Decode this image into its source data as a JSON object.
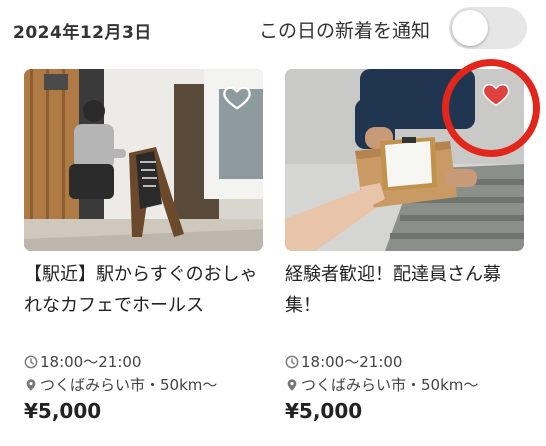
{
  "header": {
    "date": "2024年12月3日",
    "notify_label": "この日の新着を通知",
    "notify_toggle_on": false
  },
  "cards": [
    {
      "title": "【駅近】駅からすぐのおしゃれなカフェでホールス",
      "time": "18:00〜21:00",
      "location": "つくばみらい市・50km〜",
      "salary": "¥5,000",
      "favorited": false,
      "image": "cafe-staff-photo"
    },
    {
      "title": "経験者歓迎！配達員さん募集！",
      "time": "18:00〜21:00",
      "location": "つくばみらい市・50km〜",
      "salary": "¥5,000",
      "favorited": true,
      "image": "delivery-handoff-photo"
    }
  ],
  "icons": {
    "clock": "clock-icon",
    "location": "location-pin-icon",
    "favorite": "heart-icon"
  },
  "colors": {
    "favorite_active": "#e0433f",
    "annotation_ring": "#e3261b",
    "toggle_off": "#e6e6e6"
  }
}
